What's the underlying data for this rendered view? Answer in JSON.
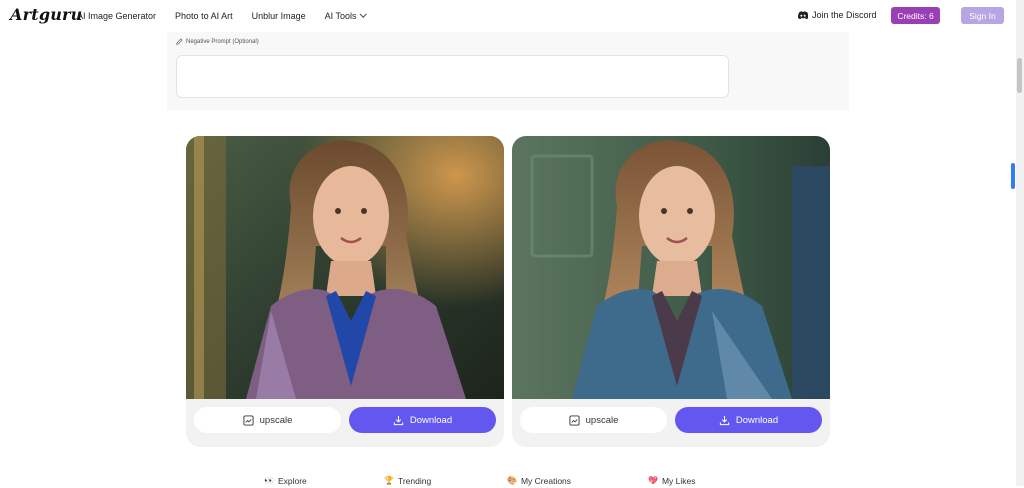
{
  "header": {
    "logo": "Artguru",
    "nav": [
      {
        "label": "AI Image Generator"
      },
      {
        "label": "Photo to AI Art"
      },
      {
        "label": "Unblur Image"
      },
      {
        "label": "AI Tools"
      }
    ],
    "discord_label": "Join the Discord",
    "credits_label": "Credits: 6",
    "signin_label": "Sign In"
  },
  "prompt": {
    "negative_label": "Negative Prompt (Optional)",
    "negative_value": ""
  },
  "cards": [
    {
      "upscale_label": "upscale",
      "download_label": "Download"
    },
    {
      "upscale_label": "upscale",
      "download_label": "Download"
    }
  ],
  "bottom_tabs": [
    {
      "label": "Explore",
      "icon": "👀"
    },
    {
      "label": "Trending",
      "icon": "🏆"
    },
    {
      "label": "My Creations",
      "icon": "🎨"
    },
    {
      "label": "My Likes",
      "icon": "💖"
    }
  ],
  "colors": {
    "credits_bg": "#9b3fb7",
    "signin_bg": "#b8a5e3",
    "download_bg": "#6457f0",
    "scroll_tab": "#2f7ef5"
  }
}
